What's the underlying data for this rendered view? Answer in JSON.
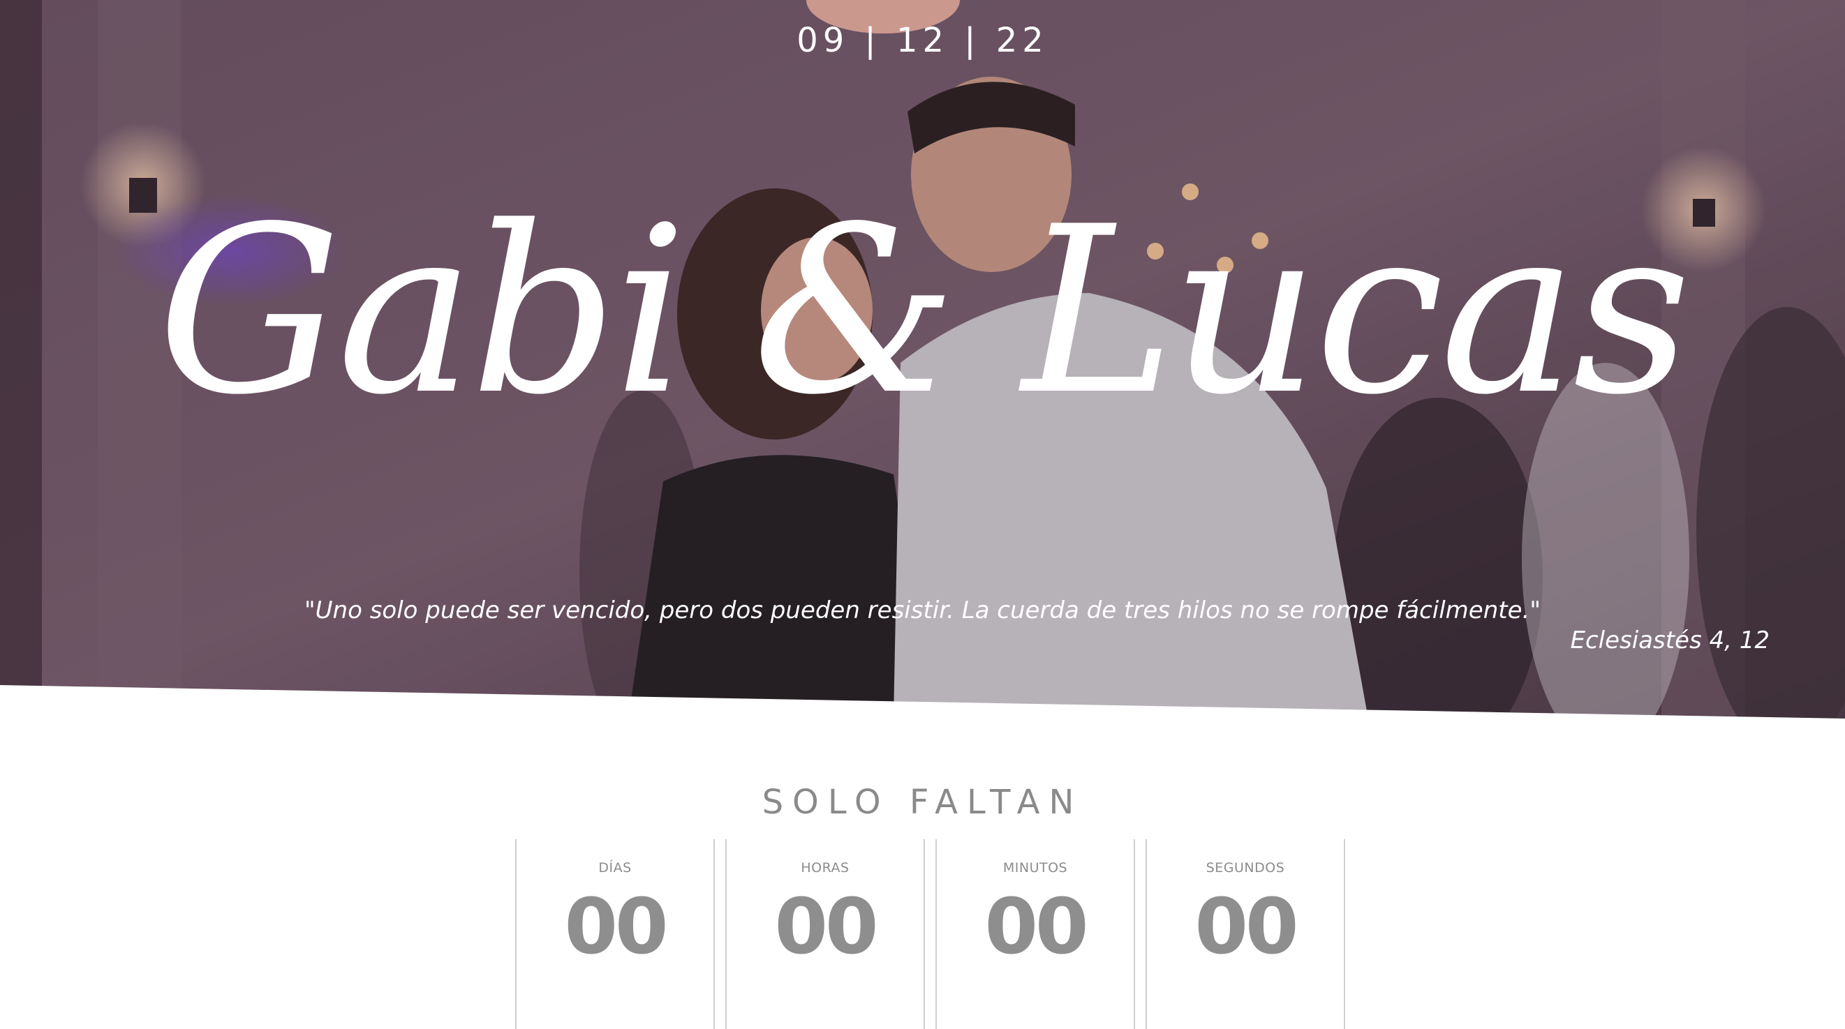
{
  "hero": {
    "date": "09 | 12 | 22",
    "names": "Gabi & Lucas",
    "quote": "\"Uno solo puede ser vencido, pero dos pueden resistir. La cuerda de tres hilos no se rompe fácilmente.\"",
    "quote_reference": "Eclesiastés 4, 12"
  },
  "countdown": {
    "title": "SOLO FALTAN",
    "units": [
      {
        "label": "DÍAS",
        "value": "00"
      },
      {
        "label": "HORAS",
        "value": "00"
      },
      {
        "label": "MINUTOS",
        "value": "00"
      },
      {
        "label": "SEGUNDOS",
        "value": "00"
      }
    ]
  },
  "colors": {
    "hero_overlay": "#5a4150",
    "countdown_text": "#8e8e8e",
    "hero_text": "#ffffff"
  }
}
